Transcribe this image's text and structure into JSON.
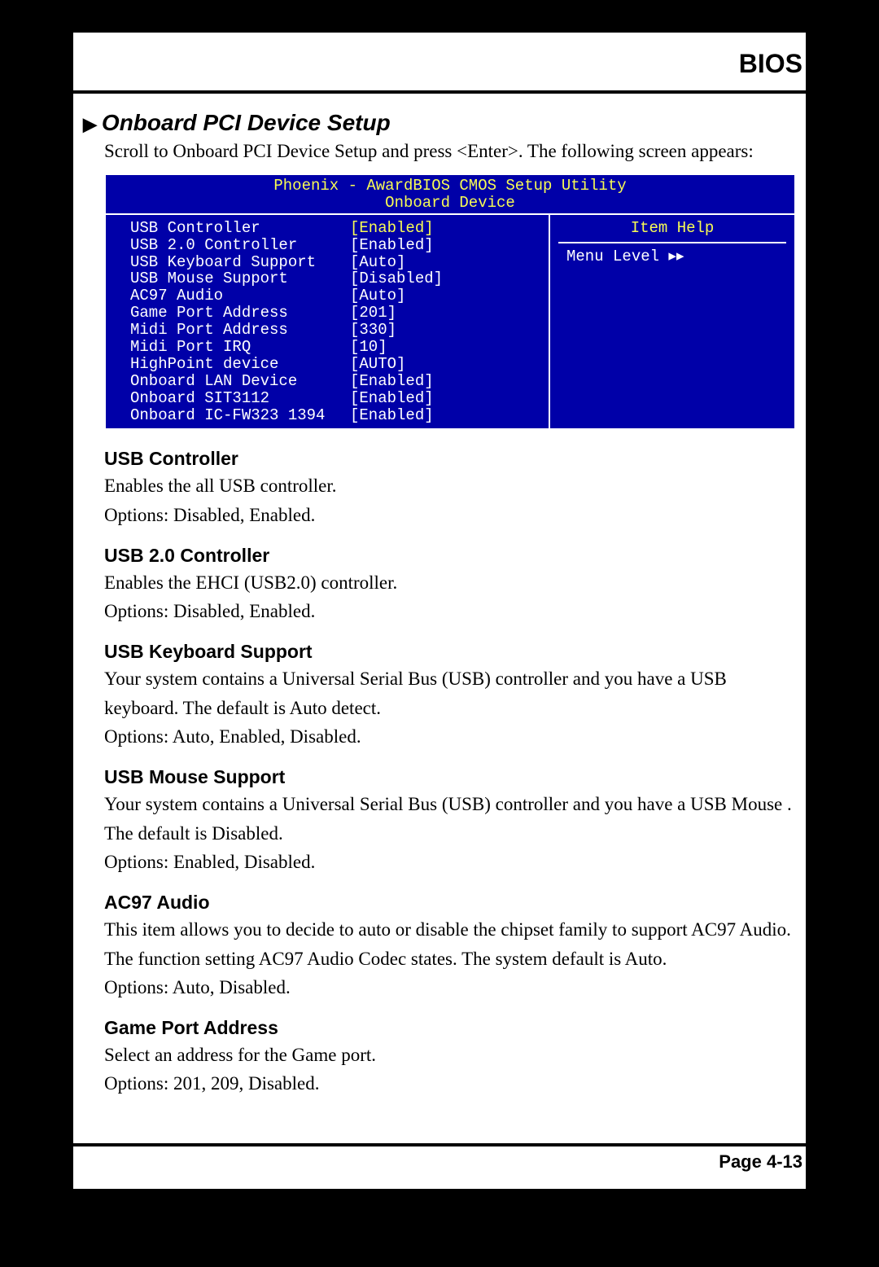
{
  "header": {
    "title": "BIOS"
  },
  "section": {
    "arrow": "▶",
    "title": "Onboard PCI Device Setup",
    "intro": "Scroll to Onboard PCI Device Setup and press <Enter>. The following screen appears:"
  },
  "bios": {
    "top1": "Phoenix - AwardBIOS CMOS Setup Utility",
    "top2": "Onboard Device",
    "right": {
      "itemhelp": "Item Help",
      "menulevel": "Menu Level   ▸▸"
    },
    "rows": [
      {
        "label": "USB Controller",
        "value": "[Enabled]",
        "sel": true
      },
      {
        "label": "USB 2.0 Controller",
        "value": "[Enabled]",
        "sel": false
      },
      {
        "label": "USB Keyboard Support",
        "value": "[Auto]",
        "sel": false
      },
      {
        "label": "USB Mouse Support",
        "value": "[Disabled]",
        "sel": false
      },
      {
        "label": "AC97 Audio",
        "value": "[Auto]",
        "sel": false
      },
      {
        "label": "Game Port Address",
        "value": "[201]",
        "sel": false
      },
      {
        "label": "Midi Port Address",
        "value": "[330]",
        "sel": false
      },
      {
        "label": "Midi Port IRQ",
        "value": "[10]",
        "sel": false
      },
      {
        "label": "HighPoint device",
        "value": "[AUTO]",
        "sel": false
      },
      {
        "label": "Onboard LAN Device",
        "value": "[Enabled]",
        "sel": false
      },
      {
        "label": "Onboard SIT3112",
        "value": "[Enabled]",
        "sel": false
      },
      {
        "label": "Onboard IC-FW323 1394",
        "value": "[Enabled]",
        "sel": false
      }
    ]
  },
  "items": [
    {
      "heading": "USB Controller",
      "body": "Enables the all USB controller.\nOptions: Disabled, Enabled."
    },
    {
      "heading": "USB 2.0 Controller",
      "body": "Enables the EHCI (USB2.0) controller.\nOptions: Disabled, Enabled."
    },
    {
      "heading": "USB Keyboard Support",
      "body": "Your system contains a Universal Serial Bus (USB) controller and you have a USB keyboard. The default is Auto detect.\nOptions: Auto, Enabled, Disabled."
    },
    {
      "heading": "USB Mouse Support",
      "body": "Your system contains a Universal Serial Bus (USB) controller and you have a USB Mouse . The default is Disabled.\nOptions: Enabled, Disabled."
    },
    {
      "heading": "AC97 Audio",
      "body": "This item allows you to decide to auto or disable the chipset family to support AC97 Audio. The function setting AC97 Audio Codec states.  The system default is Auto.\nOptions: Auto, Disabled."
    },
    {
      "heading": "Game Port Address",
      "body": "Select an address for the Game port.\nOptions: 201, 209, Disabled."
    }
  ],
  "footer": {
    "page": "Page 4-13"
  }
}
